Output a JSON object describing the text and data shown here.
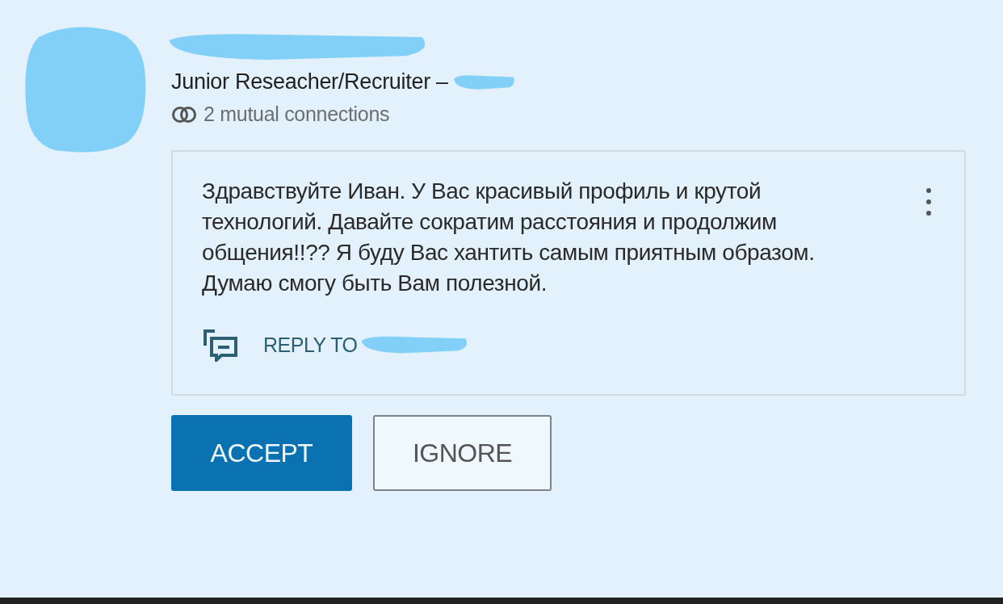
{
  "invitation": {
    "headline": "Junior Reseacher/Recruiter –",
    "mutual": "2 mutual connections",
    "message": "Здравствуйте Иван. У Вас красивый профиль и крутой технологий. Давайте сократим расстояния и продолжим общения!!?? Я буду Вас хантить самым приятным образом. Думаю смогу быть Вам полезной.",
    "reply": "REPLY TO",
    "buttons": [
      {
        "label": "ACCEPT",
        "kind": "primary"
      },
      {
        "label": "IGNORE",
        "kind": "secondary"
      }
    ]
  }
}
